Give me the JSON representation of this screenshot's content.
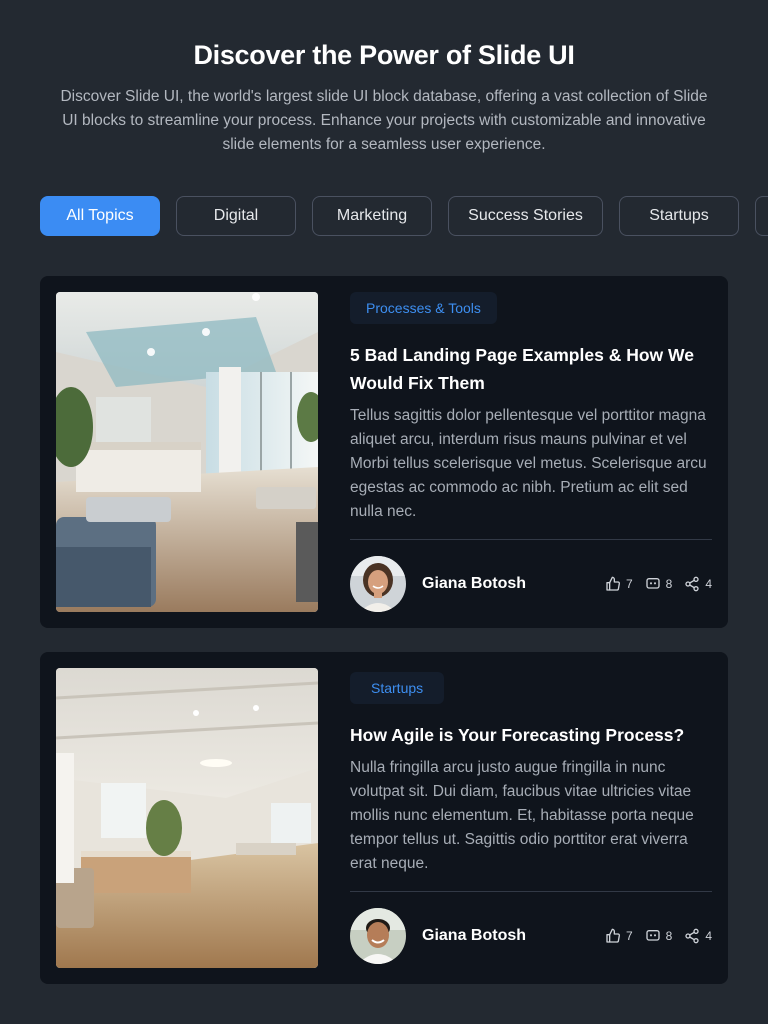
{
  "hero": {
    "title": "Discover the Power of Slide UI",
    "description": "Discover Slide UI, the world's largest slide UI block database, offering a vast collection of Slide UI blocks to streamline your process. Enhance your projects with customizable and innovative slide elements for a seamless user experience."
  },
  "filters": {
    "items": [
      {
        "label": "All Topics",
        "active": true
      },
      {
        "label": "Digital",
        "active": false
      },
      {
        "label": "Marketing",
        "active": false
      },
      {
        "label": "Success Stories",
        "active": false
      },
      {
        "label": "Startups",
        "active": false
      }
    ]
  },
  "colors": {
    "background": "#232931",
    "card": "#0f141c",
    "accent": "#3b8cf3",
    "tag_text": "#3d8ef0"
  },
  "articles": [
    {
      "tag": "Processes & Tools",
      "title": "5 Bad Landing Page Examples & How We Would Fix Them",
      "description": "Tellus sagittis dolor pellentesque vel porttitor magna aliquet arcu, interdum risus mauns pulvinar et vel Morbi tellus scelerisque vel metus. Scelerisque arcu egestas ac commodo ac nibh. Pretium ac elit sed nulla nec.",
      "author": "Giana Botosh",
      "likes": "7",
      "comments": "8",
      "shares": "4",
      "image_icon": "office-interior-photo",
      "avatar_icon": "woman-portrait"
    },
    {
      "tag": "Startups",
      "title": "How Agile is Your Forecasting Process?",
      "description": "Nulla fringilla arcu justo augue fringilla in nunc volutpat sit. Dui diam, faucibus vitae ultricies vitae mollis nunc elementum. Et, habitasse porta neque tempor tellus ut. Sagittis odio porttitor erat viverra erat neque.",
      "author": "Giana Botosh",
      "likes": "7",
      "comments": "8",
      "shares": "4",
      "image_icon": "office-interior-photo",
      "avatar_icon": "man-portrait"
    }
  ]
}
